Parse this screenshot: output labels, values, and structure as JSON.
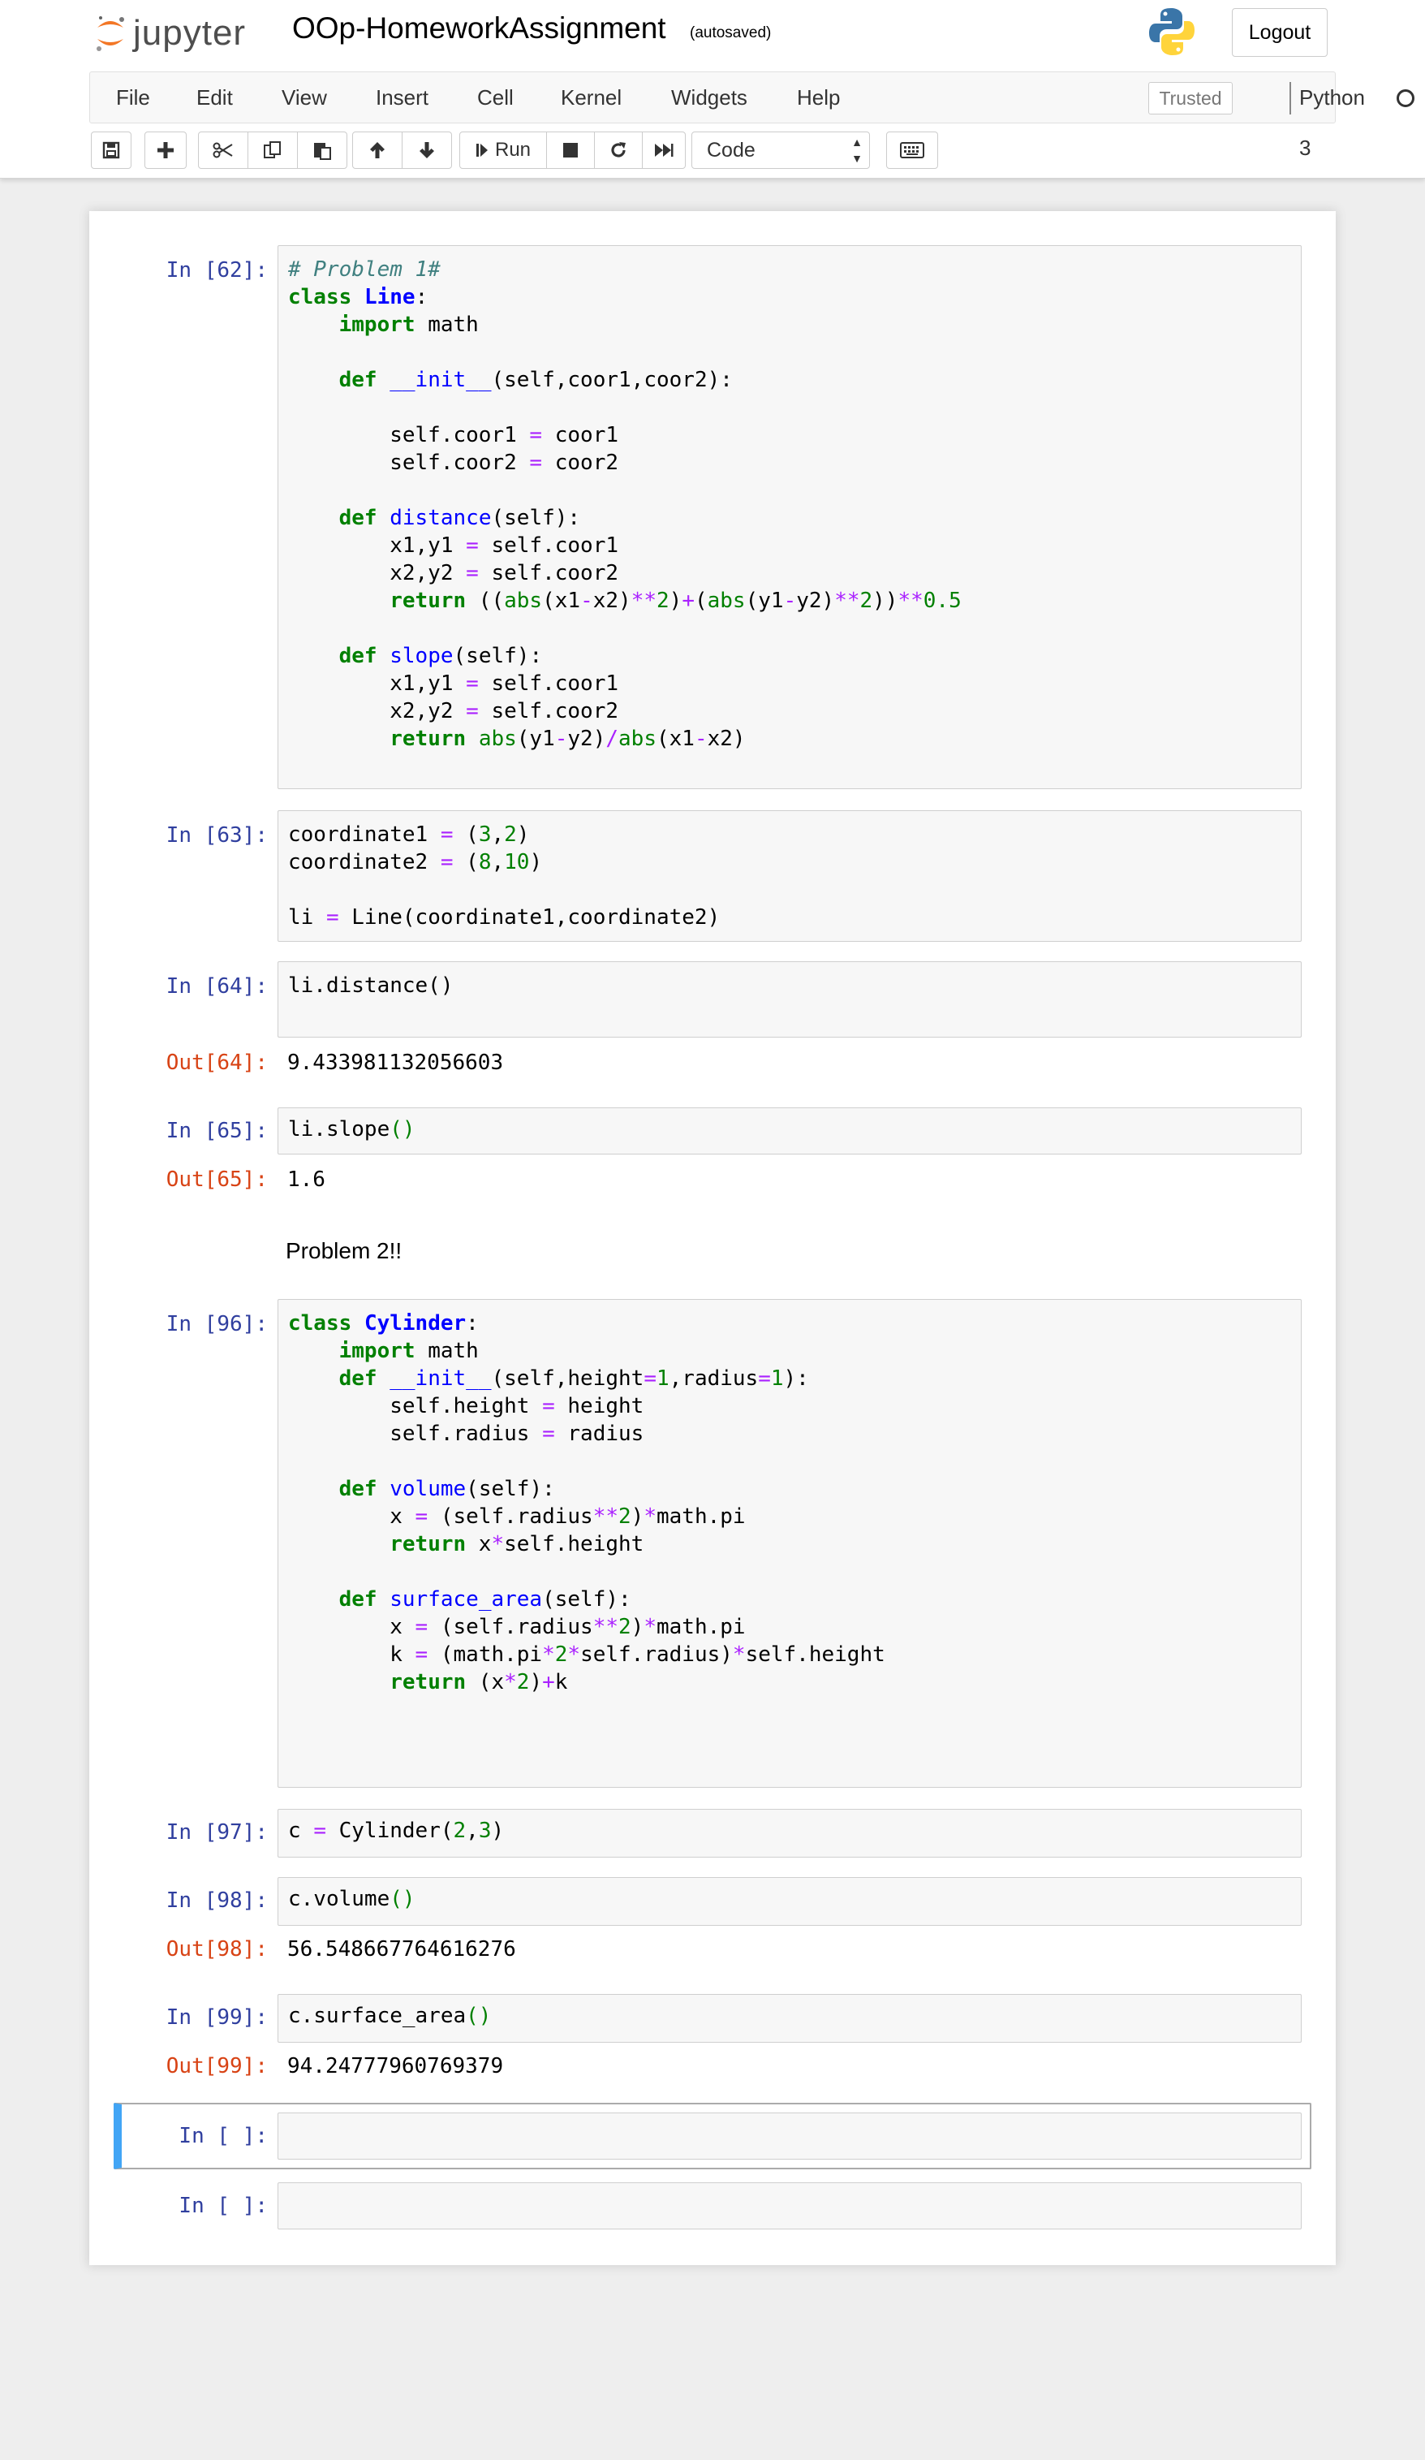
{
  "header": {
    "logo_text": "jupyter",
    "notebook_title": "OOp-HomeworkAssignment",
    "autosave_status": "(autosaved)",
    "logout_label": "Logout"
  },
  "menubar": {
    "items": [
      "File",
      "Edit",
      "View",
      "Insert",
      "Cell",
      "Kernel",
      "Widgets",
      "Help"
    ],
    "trusted_label": "Trusted",
    "kernel_name": "Python 3"
  },
  "toolbar": {
    "buttons": [
      "save-icon",
      "plus-icon",
      "cut-icon",
      "copy-icon",
      "paste-icon",
      "arrow-up-icon",
      "arrow-down-icon",
      "run-icon",
      "stop-icon",
      "restart-icon",
      "fast-forward-icon",
      "keyboard-icon"
    ],
    "run_label": "Run",
    "cell_type": "Code"
  },
  "cells": [
    {
      "prompt": "In [62]:",
      "lines": [
        "# Problem 1#",
        "class Line:",
        "    import math",
        "",
        "    def __init__(self,coor1,coor2):",
        "",
        "        self.coor1 = coor1",
        "        self.coor2 = coor2",
        "",
        "    def distance(self):",
        "        x1,y1 = self.coor1",
        "        x2,y2 = self.coor2",
        "        return ((abs(x1-x2)**2)+(abs(y1-y2)**2))**0.5",
        "",
        "    def slope(self):",
        "        x1,y1 = self.coor1",
        "        x2,y2 = self.coor2",
        "        return abs(y1-y2)/abs(x1-x2)"
      ]
    },
    {
      "prompt": "In [63]:",
      "lines": [
        "coordinate1 = (3,2)",
        "coordinate2 = (8,10)",
        "",
        "li = Line(coordinate1,coordinate2)"
      ]
    },
    {
      "prompt": "In [64]:",
      "lines": [
        "li.distance()"
      ],
      "out_prompt": "Out[64]:",
      "output": "9.433981132056603"
    },
    {
      "prompt": "In [65]:",
      "lines": [
        "li.slope()"
      ],
      "out_prompt": "Out[65]:",
      "output": "1.6"
    },
    {
      "markdown": "Problem 2!!"
    },
    {
      "prompt": "In [96]:",
      "lines": [
        "class Cylinder:",
        "    import math",
        "    def __init__(self,height=1,radius=1):",
        "        self.height = height",
        "        self.radius = radius",
        "",
        "    def volume(self):",
        "        x = (self.radius**2)*math.pi",
        "        return x*self.height",
        "",
        "    def surface_area(self):",
        "        x = (self.radius**2)*math.pi",
        "        k = (math.pi*2*self.radius)*self.height",
        "        return (x*2)+k"
      ]
    },
    {
      "prompt": "In [97]:",
      "lines": [
        "c = Cylinder(2,3)"
      ]
    },
    {
      "prompt": "In [98]:",
      "lines": [
        "c.volume()"
      ],
      "out_prompt": "Out[98]:",
      "output": "56.548667764616276"
    },
    {
      "prompt": "In [99]:",
      "lines": [
        "c.surface_area()"
      ],
      "out_prompt": "Out[99]:",
      "output": "94.24777960769379"
    },
    {
      "prompt": "In [ ]:",
      "lines": [
        ""
      ]
    },
    {
      "prompt": "In [ ]:",
      "lines": [
        ""
      ]
    }
  ],
  "colors": {
    "in_prompt": "#303f9f",
    "out_prompt": "#d84315",
    "keyword": "#008000",
    "function_name": "#0000ff",
    "operator": "#aa22ff",
    "comment": "#408080",
    "selected_cell_border": "#42a5f5"
  }
}
